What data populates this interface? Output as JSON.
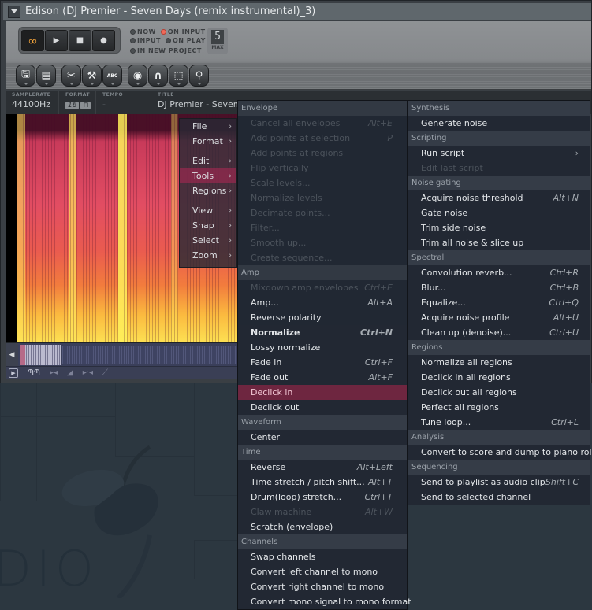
{
  "window": {
    "title": "Edison (DJ Premier - Seven Days (remix instrumental)_3)"
  },
  "transport": {
    "buttons": [
      {
        "name": "loop",
        "glyph": "∞"
      },
      {
        "name": "play",
        "glyph": "▶"
      },
      {
        "name": "stop",
        "glyph": "■"
      },
      {
        "name": "record",
        "glyph": "●"
      }
    ]
  },
  "record_options": {
    "now": "NOW",
    "input": "INPUT",
    "on_input": "ON INPUT",
    "on_play": "ON PLAY",
    "in_new_project": "IN NEW PROJECT",
    "on_input_active": true
  },
  "max": {
    "value": "5",
    "label": "MAX"
  },
  "toolbar": [
    {
      "icon": "save-icon",
      "glyph": "💾"
    },
    {
      "icon": "document-icon",
      "glyph": "▤"
    },
    {
      "icon": "scissors-icon",
      "glyph": "✂"
    },
    {
      "icon": "wrench-icon",
      "glyph": "🔧"
    },
    {
      "icon": "marker-abc-icon",
      "glyph": "ABC"
    },
    {
      "icon": "eye-icon",
      "glyph": "◉"
    },
    {
      "icon": "magnet-icon",
      "glyph": "∩"
    },
    {
      "icon": "selection-icon",
      "glyph": "⬚"
    },
    {
      "icon": "zoom-icon",
      "glyph": "🔍"
    }
  ],
  "info": {
    "samplerate_label": "SAMPLERATE",
    "samplerate": "44100Hz",
    "format_label": "FORMAT",
    "format_bits": "16",
    "tempo_label": "TEMPO",
    "tempo": "-",
    "title_label": "TITLE",
    "title": "DJ Premier - Seven Days (remix instrumental)"
  },
  "main_menu": {
    "items": [
      {
        "label": "File",
        "has_sub": true
      },
      {
        "label": "Format",
        "has_sub": true
      },
      {
        "label": "Edit",
        "has_sub": true
      },
      {
        "label": "Tools",
        "has_sub": true,
        "active": true
      },
      {
        "label": "Regions",
        "has_sub": true
      },
      {
        "label": "View",
        "has_sub": true
      },
      {
        "label": "Snap",
        "has_sub": true
      },
      {
        "label": "Select",
        "has_sub": true
      },
      {
        "label": "Zoom",
        "has_sub": true
      }
    ]
  },
  "tools_menu_left": {
    "sections": [
      {
        "header": "Envelope",
        "items": [
          {
            "label": "Cancel all envelopes",
            "shortcut": "Alt+E",
            "disabled": true
          },
          {
            "label": "Add points at selection",
            "shortcut": "P",
            "disabled": true
          },
          {
            "label": "Add points at regions",
            "shortcut": "",
            "disabled": true
          },
          {
            "label": "Flip vertically",
            "shortcut": "",
            "disabled": true
          },
          {
            "label": "Scale levels...",
            "shortcut": "",
            "disabled": true
          },
          {
            "label": "Normalize levels",
            "shortcut": "",
            "disabled": true
          },
          {
            "label": "Decimate points...",
            "shortcut": "",
            "disabled": true
          },
          {
            "label": "Filter...",
            "shortcut": "",
            "disabled": true
          },
          {
            "label": "Smooth up...",
            "shortcut": "",
            "disabled": true
          },
          {
            "label": "Create sequence...",
            "shortcut": "",
            "disabled": true
          }
        ]
      },
      {
        "header": "Amp",
        "items": [
          {
            "label": "Mixdown amp envelopes",
            "shortcut": "Ctrl+E",
            "disabled": true
          },
          {
            "label": "Amp...",
            "shortcut": "Alt+A"
          },
          {
            "label": "Reverse polarity",
            "shortcut": ""
          },
          {
            "label": "Normalize",
            "shortcut": "Ctrl+N",
            "bold": true
          },
          {
            "label": "Lossy normalize",
            "shortcut": ""
          },
          {
            "label": "Fade in",
            "shortcut": "Ctrl+F"
          },
          {
            "label": "Fade out",
            "shortcut": "Alt+F"
          },
          {
            "label": "Declick in",
            "shortcut": "",
            "highlighted": true
          },
          {
            "label": "Declick out",
            "shortcut": ""
          }
        ]
      },
      {
        "header": "Waveform",
        "items": [
          {
            "label": "Center",
            "shortcut": ""
          }
        ]
      },
      {
        "header": "Time",
        "items": [
          {
            "label": "Reverse",
            "shortcut": "Alt+Left"
          },
          {
            "label": "Time stretch / pitch shift...",
            "shortcut": "Alt+T"
          },
          {
            "label": "Drum(loop) stretch...",
            "shortcut": "Ctrl+T"
          },
          {
            "label": "Claw machine",
            "shortcut": "Alt+W",
            "disabled": true
          },
          {
            "label": "Scratch (envelope)",
            "shortcut": ""
          }
        ]
      },
      {
        "header": "Channels",
        "items": [
          {
            "label": "Swap channels",
            "shortcut": ""
          },
          {
            "label": "Convert left channel to mono",
            "shortcut": ""
          },
          {
            "label": "Convert right channel to mono",
            "shortcut": ""
          },
          {
            "label": "Convert mono signal to mono format",
            "shortcut": ""
          }
        ]
      }
    ]
  },
  "tools_menu_right": {
    "sections": [
      {
        "header": "Synthesis",
        "items": [
          {
            "label": "Generate noise",
            "shortcut": ""
          }
        ]
      },
      {
        "header": "Scripting",
        "items": [
          {
            "label": "Run script",
            "shortcut": "›"
          },
          {
            "label": "Edit last script",
            "shortcut": "",
            "disabled": true
          }
        ]
      },
      {
        "header": "Noise gating",
        "items": [
          {
            "label": "Acquire noise threshold",
            "shortcut": "Alt+N"
          },
          {
            "label": "Gate noise",
            "shortcut": ""
          },
          {
            "label": "Trim side noise",
            "shortcut": ""
          },
          {
            "label": "Trim all noise & slice up",
            "shortcut": ""
          }
        ]
      },
      {
        "header": "Spectral",
        "items": [
          {
            "label": "Convolution reverb...",
            "shortcut": "Ctrl+R"
          },
          {
            "label": "Blur...",
            "shortcut": "Ctrl+B"
          },
          {
            "label": "Equalize...",
            "shortcut": "Ctrl+Q"
          },
          {
            "label": "Acquire noise profile",
            "shortcut": "Alt+U"
          },
          {
            "label": "Clean up (denoise)...",
            "shortcut": "Ctrl+U"
          }
        ]
      },
      {
        "header": "Regions",
        "items": [
          {
            "label": "Normalize all regions",
            "shortcut": ""
          },
          {
            "label": "Declick in all regions",
            "shortcut": ""
          },
          {
            "label": "Declick out all regions",
            "shortcut": ""
          },
          {
            "label": "Perfect all regions",
            "shortcut": ""
          },
          {
            "label": "Tune loop...",
            "shortcut": "Ctrl+L"
          }
        ]
      },
      {
        "header": "Analysis",
        "items": [
          {
            "label": "Convert to score and dump to piano roll",
            "shortcut": ""
          }
        ]
      },
      {
        "header": "Sequencing",
        "items": [
          {
            "label": "Send to playlist as audio clip",
            "shortcut": "Shift+C"
          },
          {
            "label": "Send to selected channel",
            "shortcut": ""
          }
        ]
      }
    ]
  },
  "bottom_tools": [
    {
      "icon": "play-icon",
      "glyph": "▶"
    },
    {
      "icon": "waveform-icon",
      "glyph": "ՊՊ"
    },
    {
      "icon": "trim-icon",
      "glyph": "▸◂"
    },
    {
      "icon": "ramp-icon",
      "glyph": "◢"
    },
    {
      "icon": "crossfade-icon",
      "glyph": "▸·◂"
    },
    {
      "icon": "envelope-line-icon",
      "glyph": "⟋"
    }
  ],
  "desktop": {
    "logo_text": "DIO"
  }
}
